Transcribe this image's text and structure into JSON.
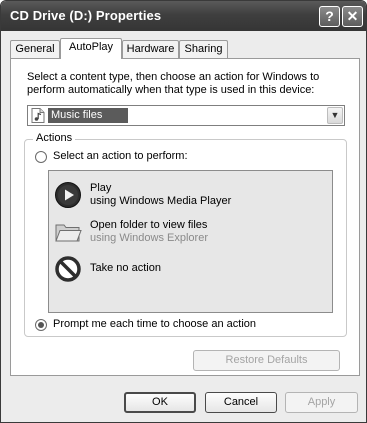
{
  "window": {
    "title": "CD Drive (D:) Properties",
    "help_glyph": "?",
    "close_glyph": "✕"
  },
  "tabs": [
    {
      "label": "General",
      "active": false
    },
    {
      "label": "AutoPlay",
      "active": true
    },
    {
      "label": "Hardware",
      "active": false
    },
    {
      "label": "Sharing",
      "active": false
    }
  ],
  "autoplay": {
    "intro": "Select a content type, then choose an action for Windows to perform automatically when that type is used in this device:",
    "content_type": {
      "selected": "Music files",
      "icon": "music-file-icon"
    },
    "actions_group": {
      "legend": "Actions",
      "select_action_label": "Select an action to perform:",
      "select_action_checked": false,
      "prompt_label": "Prompt me each time to choose an action",
      "prompt_checked": true,
      "items": [
        {
          "title": "Play",
          "subtitle": "using Windows Media Player",
          "icon": "play-icon",
          "enabled": true
        },
        {
          "title": "Open folder to view files",
          "subtitle": "using Windows Explorer",
          "icon": "folder-icon",
          "enabled": true
        },
        {
          "title": "Take no action",
          "subtitle": "",
          "icon": "no-action-icon",
          "enabled": true
        }
      ]
    },
    "restore_label": "Restore Defaults"
  },
  "footer": {
    "ok_label": "OK",
    "cancel_label": "Cancel",
    "apply_label": "Apply"
  },
  "colors": {
    "titlebar": "#3f3f3f",
    "selection": "#5b5b5b",
    "dialog_bg": "#ececec",
    "disabled_text": "#a4a4a4"
  }
}
